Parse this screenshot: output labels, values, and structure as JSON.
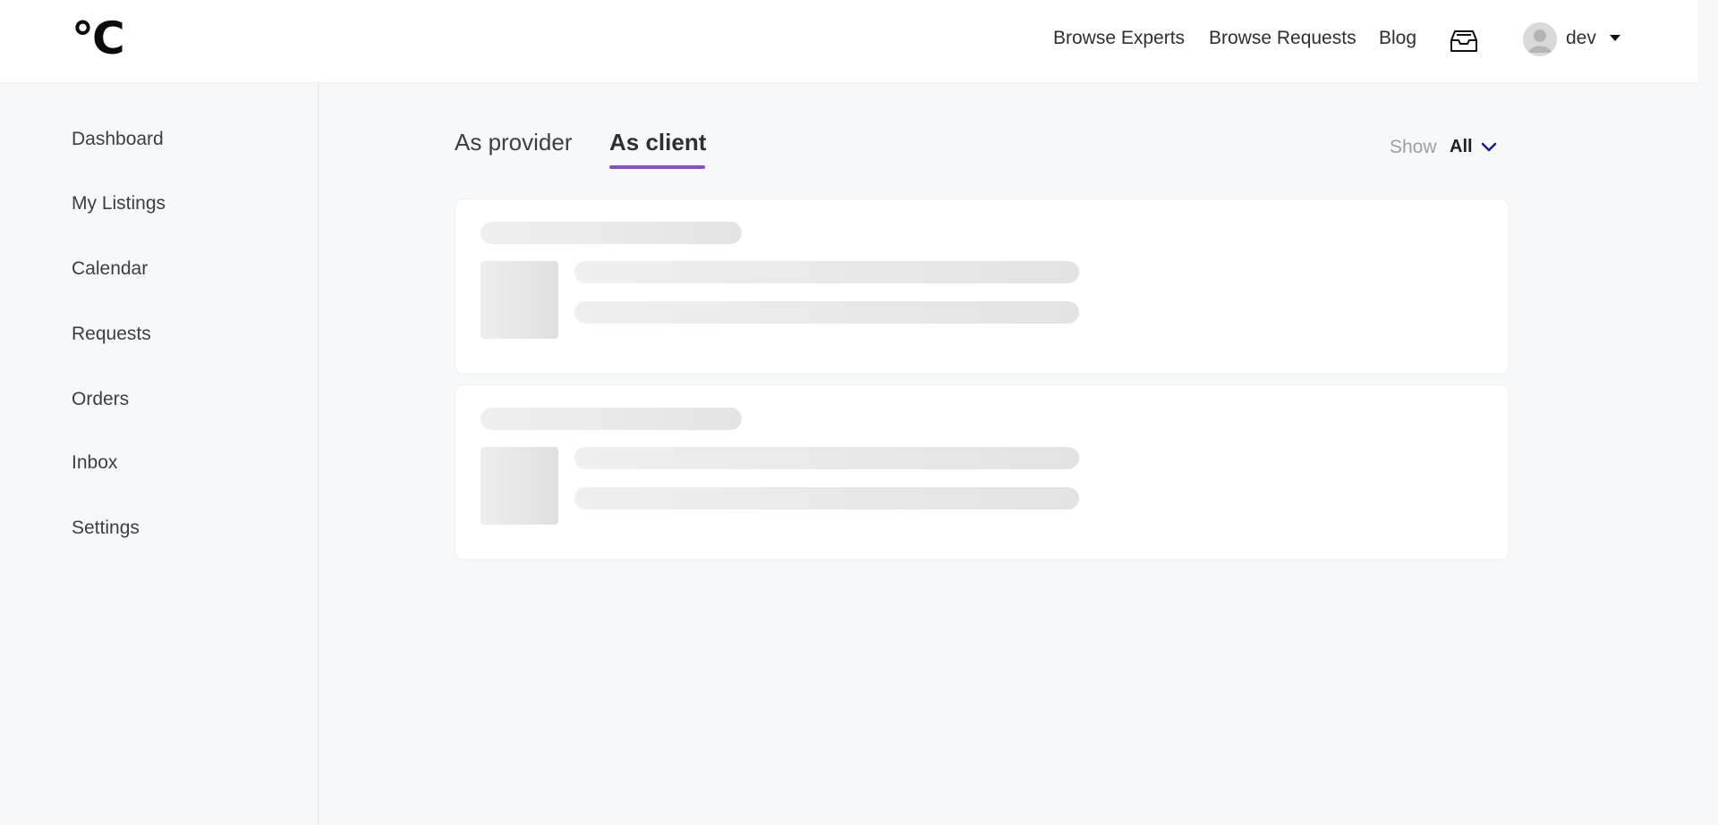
{
  "header": {
    "logo": "°C",
    "nav": {
      "browse_experts": "Browse Experts",
      "browse_requests": "Browse Requests",
      "blog": "Blog"
    },
    "inbox_icon": "inbox-tray-icon",
    "user": {
      "name": "dev",
      "avatar_icon": "user-avatar-icon",
      "menu_icon": "caret-down-icon"
    }
  },
  "sidebar": {
    "items": [
      {
        "label": "Dashboard"
      },
      {
        "label": "My Listings"
      },
      {
        "label": "Calendar"
      },
      {
        "label": "Requests"
      },
      {
        "label": "Orders"
      },
      {
        "label": "Inbox"
      },
      {
        "label": "Settings"
      }
    ]
  },
  "main": {
    "tabs": [
      {
        "label": "As provider",
        "active": false
      },
      {
        "label": "As client",
        "active": true
      }
    ],
    "filter": {
      "label": "Show",
      "value": "All",
      "icon": "chevron-down-icon"
    },
    "loading_cards": 2
  },
  "colors": {
    "accent": "#8a4bdb",
    "chevron": "#1a1aa8",
    "background": "#f7f8fa",
    "skeleton": "#e6e6e6"
  }
}
